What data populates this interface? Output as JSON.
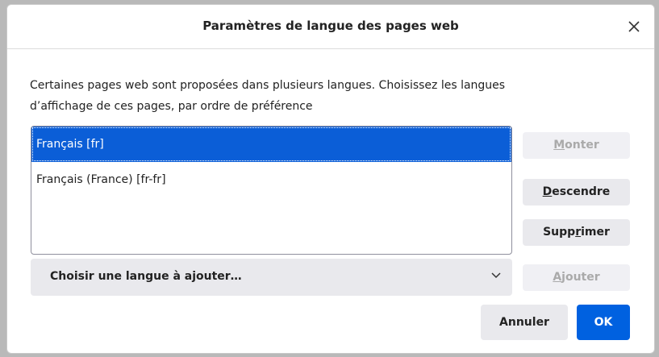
{
  "dialog": {
    "title": "Paramètres de langue des pages web",
    "close_label": "×",
    "description_line1": "Certaines pages web sont proposées dans plusieurs langues. Choisissez les langues",
    "description_line2": "d’affichage de ces pages, par ordre de préférence"
  },
  "languages": [
    {
      "label": "Français [fr]",
      "selected": true
    },
    {
      "label": "Français (France) [fr-fr]",
      "selected": false
    }
  ],
  "buttons": {
    "move_up": {
      "pre": "",
      "accel": "M",
      "post": "onter",
      "disabled": true
    },
    "move_down": {
      "pre": "",
      "accel": "D",
      "post": "escendre",
      "disabled": false
    },
    "remove": {
      "pre": "Supp",
      "accel": "r",
      "post": "imer",
      "disabled": false
    },
    "add": {
      "pre": "",
      "accel": "A",
      "post": "jouter",
      "disabled": true
    },
    "cancel": "Annuler",
    "ok": "OK"
  },
  "language_select": {
    "placeholder": "Choisir une langue à ajouter…"
  },
  "colors": {
    "selection": "#0b5ed7",
    "primary_button": "#0061e0",
    "button_bg": "#e9e9ed"
  }
}
